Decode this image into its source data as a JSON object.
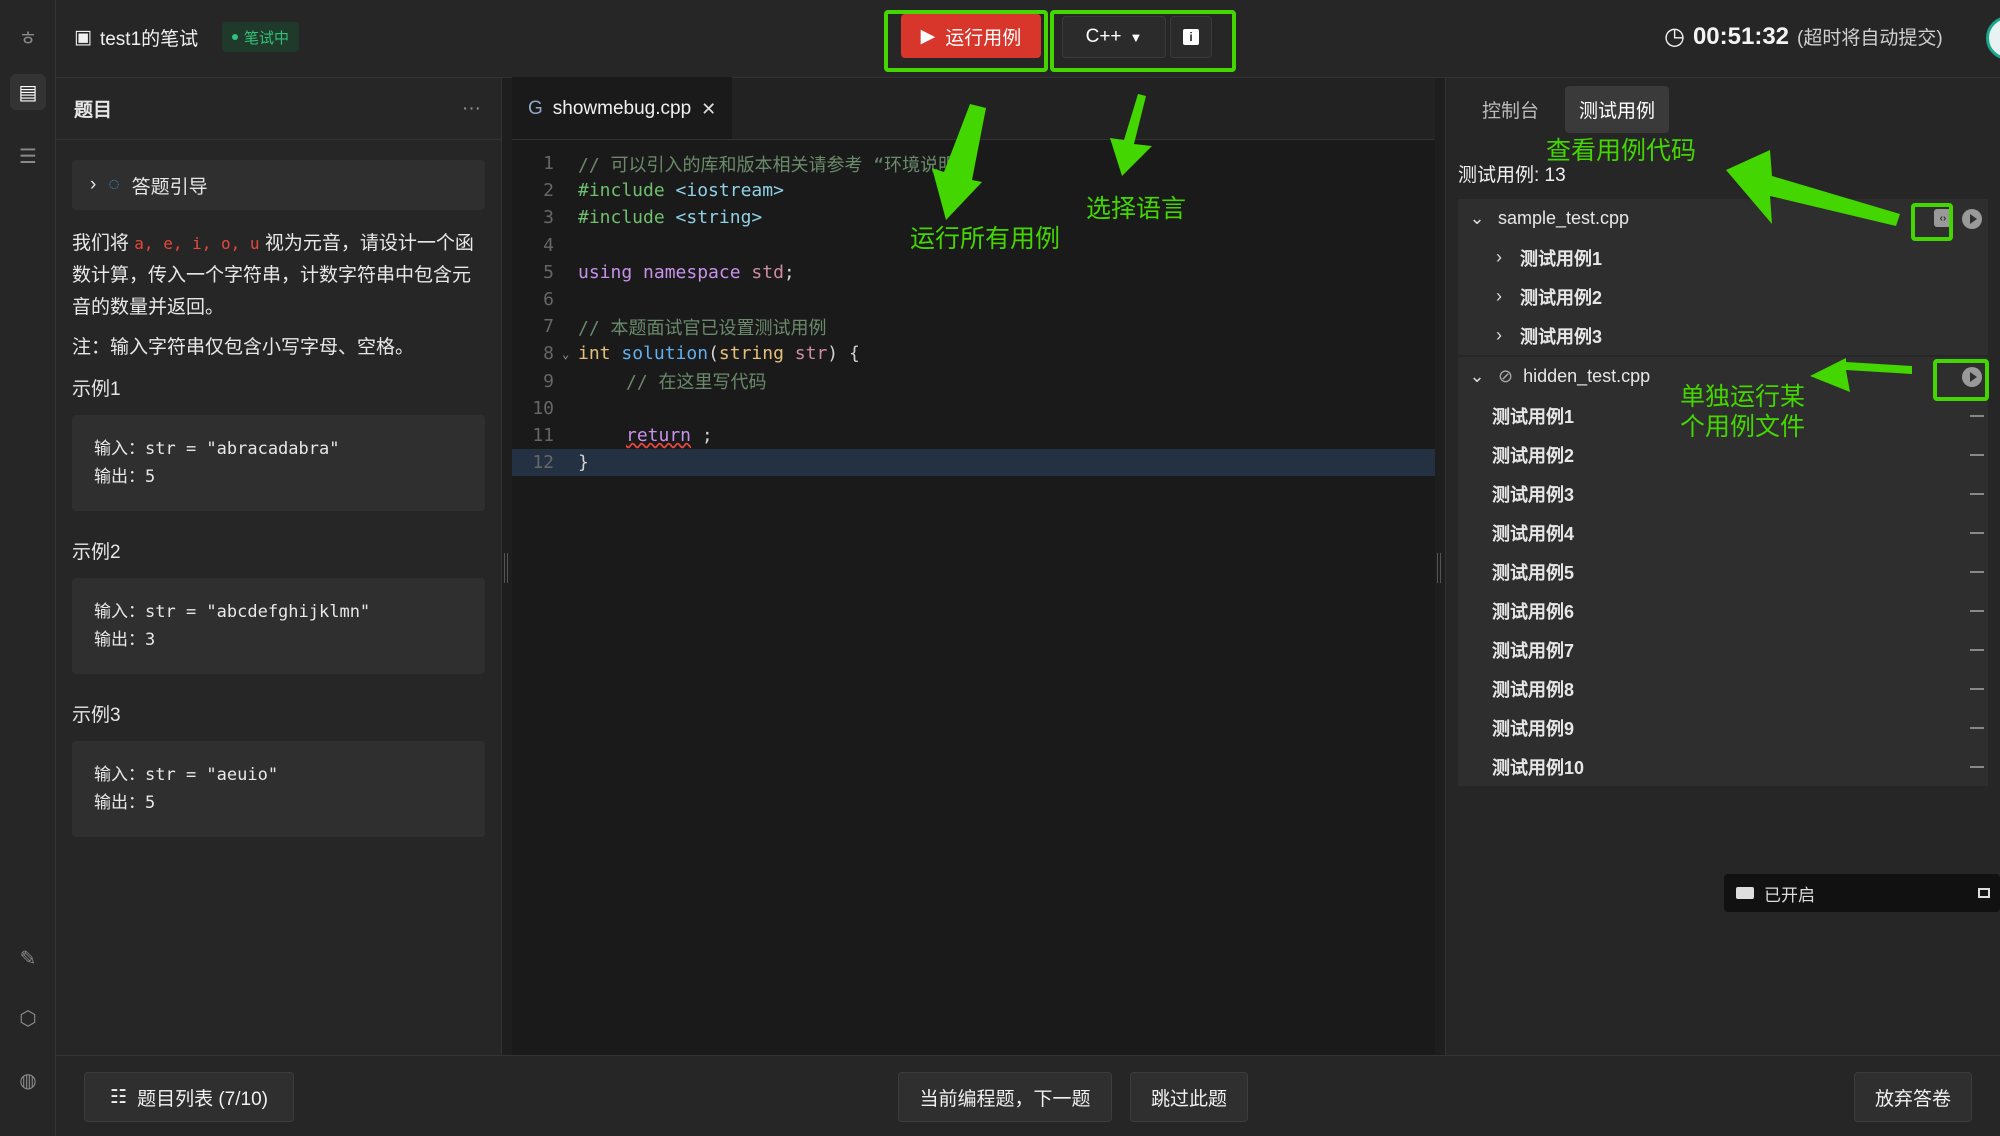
{
  "header": {
    "title": "test1的笔试",
    "status_badge": "笔试中",
    "run_button": "运行用例",
    "language": "C++",
    "info_label": "i",
    "timer": "00:51:32",
    "timer_note": "(超时将自动提交)"
  },
  "question": {
    "header": "题目",
    "more": "···",
    "guide": "答题引导",
    "desc_pre": "我们将",
    "vowels": "a, e, i, o, u",
    "desc_post": "视为元音，请设计一个函数计算，传入一个字符串，计数字符串中包含元音的数量并返回。",
    "note": "注：输入字符串仅包含小写字母、空格。",
    "examples": [
      {
        "label": "示例1",
        "input": "输入：str = \"abracadabra\"",
        "output": "输出：5"
      },
      {
        "label": "示例2",
        "input": "输入：str = \"abcdefghijklmn\"",
        "output": "输出：3"
      },
      {
        "label": "示例3",
        "input": "输入：str = \"aeuio\"",
        "output": "输出：5"
      }
    ]
  },
  "editor": {
    "tab_name": "showmebug.cpp",
    "tab_close": "✕",
    "line_numbers": [
      "1",
      "2",
      "3",
      "4",
      "5",
      "6",
      "7",
      "8",
      "9",
      "10",
      "11",
      "12"
    ],
    "code": {
      "l1": "// 可以引入的库和版本相关请参考 “环境说明”",
      "l2_kw": "#include",
      "l2_inc": "<iostream>",
      "l3_kw": "#include",
      "l3_inc": "<string>",
      "l5_kw": "using namespace",
      "l5_id": "std",
      "l5_end": ";",
      "l7": "// 本题面试官已设置测试用例",
      "l8_ty": "int",
      "l8_fn": "solution",
      "l8_a": "(",
      "l8_ty2": "string",
      "l8_id": "str",
      "l8_b": ") {",
      "l9": "// 在这里写代码",
      "l11_kw": "return",
      "l11_end": " ;",
      "l12": "}"
    }
  },
  "right": {
    "tabs": [
      "控制台",
      "测试用例"
    ],
    "count_label": "测试用例: 13",
    "sample_file": "sample_test.cpp",
    "sample_cases": [
      "测试用例1",
      "测试用例2",
      "测试用例3"
    ],
    "hidden_file": "hidden_test.cpp",
    "hidden_cases": [
      "测试用例1",
      "测试用例2",
      "测试用例3",
      "测试用例4",
      "测试用例5",
      "测试用例6",
      "测试用例7",
      "测试用例8",
      "测试用例9",
      "测试用例10"
    ],
    "recording": "已开启"
  },
  "bottom": {
    "list_button": "题目列表 (7/10)",
    "next_button": "当前编程题，下一题",
    "skip_button": "跳过此题",
    "abandon_button": "放弃答卷"
  },
  "annotations": {
    "run_all": "运行所有用例",
    "choose_lang": "选择语言",
    "view_code": "查看用例代码",
    "run_single": "单独运行某个用例文件"
  },
  "colors": {
    "accent_green": "#44d600",
    "run_red": "#d9362b",
    "status_green": "#33c07a"
  }
}
